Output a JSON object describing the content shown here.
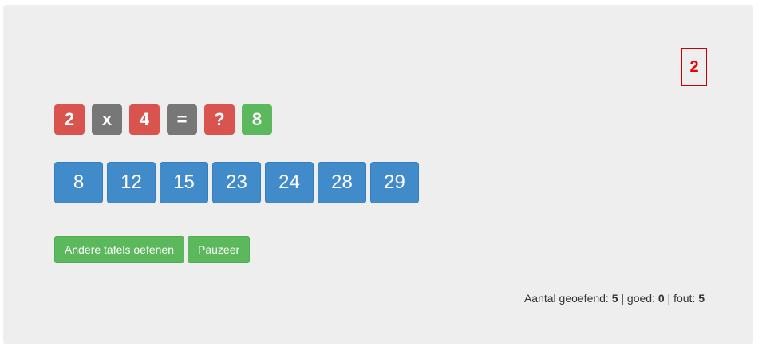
{
  "counter": {
    "value": "2"
  },
  "equation": {
    "tiles": [
      {
        "label": "2",
        "color": "#d9534f"
      },
      {
        "label": "x",
        "color": "#777777"
      },
      {
        "label": "4",
        "color": "#d9534f"
      },
      {
        "label": "=",
        "color": "#777777"
      },
      {
        "label": "?",
        "color": "#d9534f"
      },
      {
        "label": "8",
        "color": "#5cb85c"
      }
    ]
  },
  "answers": [
    "8",
    "12",
    "15",
    "23",
    "24",
    "28",
    "29"
  ],
  "actions": {
    "other_tables_label": "Andere tafels oefenen",
    "pause_label": "Pauzeer"
  },
  "stats": {
    "practiced_label": "Aantal geoefend: ",
    "practiced_value": "5",
    "sep1": " | goed: ",
    "good_value": "0",
    "sep2": " | fout: ",
    "wrong_value": "5"
  },
  "colors": {
    "panel_bg": "#eeeeee",
    "danger": "#d9534f",
    "neutral": "#777777",
    "success": "#5cb85c",
    "primary": "#428bca",
    "counter_red": "#ee0000"
  }
}
